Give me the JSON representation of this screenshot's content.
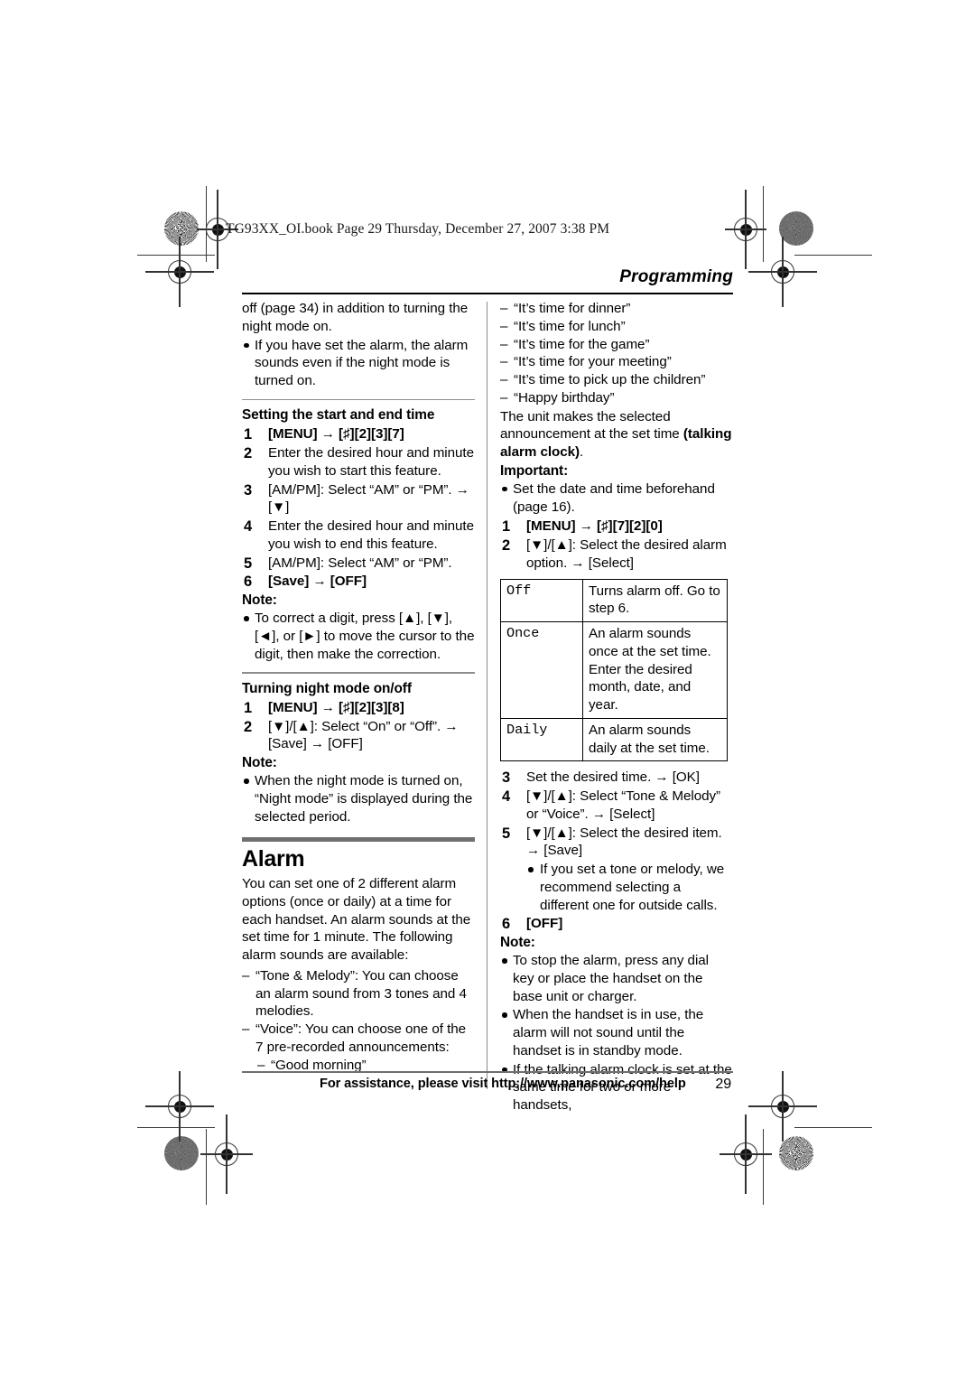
{
  "file_header": "TG93XX_OI.book  Page 29  Thursday, December 27, 2007  3:38 PM",
  "running_head": "Programming",
  "left_column": {
    "continued_text": "off (page 34) in addition to turning the night mode on.",
    "continued_bullets": [
      "If you have set the alarm, the alarm sounds even if the night mode is turned on."
    ],
    "section_start_end": {
      "heading": "Setting the start and end time",
      "steps": [
        {
          "num": "1",
          "text": "[MENU] → [♯][2][3][7]",
          "bold": true
        },
        {
          "num": "2",
          "text": "Enter the desired hour and minute you wish to start this feature.",
          "bold": false
        },
        {
          "num": "3",
          "text": "[AM/PM]: Select “AM” or “PM”. → [▼]",
          "bold": false
        },
        {
          "num": "4",
          "text": "Enter the desired hour and minute you wish to end this feature.",
          "bold": false
        },
        {
          "num": "5",
          "text": "[AM/PM]: Select “AM” or “PM”.",
          "bold": false
        },
        {
          "num": "6",
          "text": "[Save] → [OFF]",
          "bold": true
        }
      ],
      "note_label": "Note:",
      "notes": [
        "To correct a digit, press [▲], [▼], [◄], or [►] to move the cursor to the digit, then make the correction."
      ]
    },
    "section_night_mode": {
      "heading": "Turning night mode on/off",
      "steps": [
        {
          "num": "1",
          "text": "[MENU] → [♯][2][3][8]"
        },
        {
          "num": "2",
          "text": "[▼]/[▲]: Select “On” or “Off”. → [Save] → [OFF]"
        }
      ],
      "note_label": "Note:",
      "notes": [
        "When the night mode is turned on, “Night mode” is displayed during the selected period."
      ]
    },
    "section_alarm": {
      "title": "Alarm",
      "intro": "You can set one of 2 different alarm options (once or daily) at a time for each handset. An alarm sounds at the set time for 1 minute. The following alarm sounds are available:",
      "sound_options": [
        "“Tone & Melody”: You can choose an alarm sound from 3 tones and 4 melodies.",
        "“Voice”: You can choose one of the 7 pre-recorded announcements:"
      ],
      "announcement_first": "“Good morning”"
    }
  },
  "right_column": {
    "announcements": [
      "“It’s time for dinner”",
      "“It’s time for lunch”",
      "“It’s time for the game”",
      "“It’s time for your meeting”",
      "“It’s time to pick up the children”",
      "“Happy birthday”"
    ],
    "talking_alarm_text_1": "The unit makes the selected announcement at the set time ",
    "talking_alarm_bold": "(talking alarm clock)",
    "talking_alarm_text_2": ".",
    "important_label": "Important:",
    "important_notes": [
      "Set the date and time beforehand (page 16)."
    ],
    "steps": [
      {
        "num": "1",
        "text": "[MENU] → [♯][7][2][0]"
      },
      {
        "num": "2",
        "text": "[▼]/[▲]: Select the desired alarm option. → [Select]"
      }
    ],
    "option_table": {
      "rows": [
        {
          "key": "Off",
          "desc": "Turns alarm off. Go to step 6."
        },
        {
          "key": "Once",
          "desc": "An alarm sounds once at the set time. Enter the desired month, date, and year."
        },
        {
          "key": "Daily",
          "desc": "An alarm sounds daily at the set time."
        }
      ]
    },
    "steps_cont": [
      {
        "num": "3",
        "text": "Set the desired time. → [OK]"
      },
      {
        "num": "4",
        "text": "[▼]/[▲]: Select “Tone & Melody” or “Voice”. → [Select]"
      },
      {
        "num": "5",
        "text": "[▼]/[▲]: Select the desired item. → [Save]",
        "sub": [
          "If you set a tone or melody, we recommend selecting a different one for outside calls."
        ]
      },
      {
        "num": "6",
        "text": "[OFF]"
      }
    ],
    "note_label": "Note:",
    "notes": [
      "To stop the alarm, press any dial key or place the handset on the base unit or charger.",
      "When the handset is in use, the alarm will not sound until the handset is in standby mode.",
      "If the talking alarm clock is set at the same time for two or more handsets,"
    ]
  },
  "footer": {
    "assistance": "For assistance, please visit http://www.panasonic.com/help",
    "page_number": "29"
  },
  "colors": {
    "text": "#000000",
    "rule": "#6f6f6f",
    "thin_rule": "#8d8d8d"
  }
}
